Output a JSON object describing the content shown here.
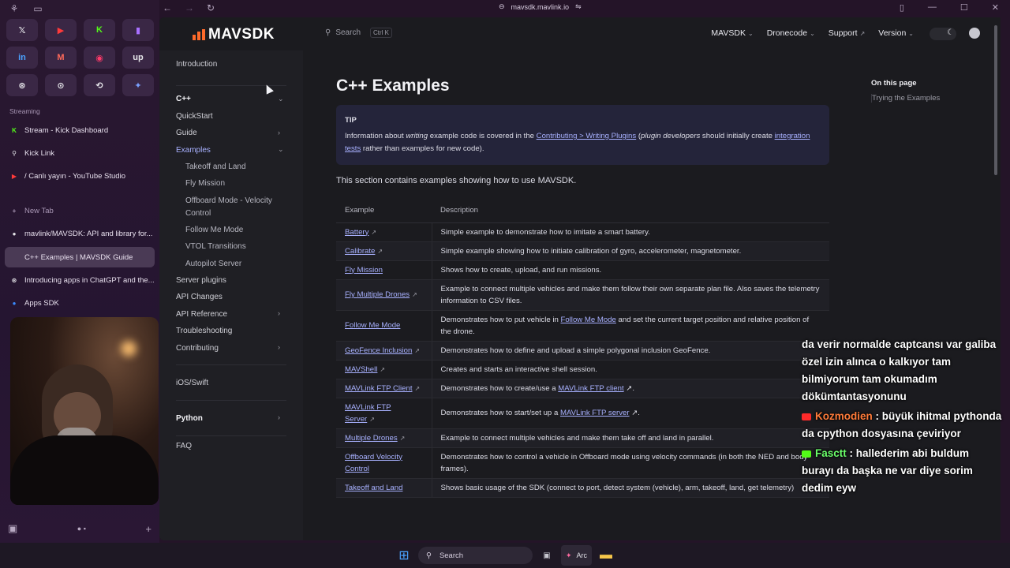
{
  "browser": {
    "url": "mavsdk.mavlink.io"
  },
  "arc": {
    "favorites": [
      {
        "icon": "x-icon",
        "glyph": "𝕏",
        "color": "#e6e6ea"
      },
      {
        "icon": "youtube-icon",
        "glyph": "▶",
        "color": "#ff3a3a"
      },
      {
        "icon": "kick-icon",
        "glyph": "K",
        "color": "#53fc18"
      },
      {
        "icon": "twitch-icon",
        "glyph": "▮",
        "color": "#a970ff"
      },
      {
        "icon": "linkedin-icon",
        "glyph": "in",
        "color": "#4aa3ff"
      },
      {
        "icon": "gmail-icon",
        "glyph": "M",
        "color": "#ff6a5a"
      },
      {
        "icon": "record-icon",
        "glyph": "◉",
        "color": "#ff3a6a"
      },
      {
        "icon": "upwork-icon",
        "glyph": "up",
        "color": "#e6e6ea"
      },
      {
        "icon": "chatgpt-icon",
        "glyph": "⊛",
        "color": "#e6e6ea"
      },
      {
        "icon": "target-icon",
        "glyph": "⊙",
        "color": "#e6e6ea"
      },
      {
        "icon": "sync-icon",
        "glyph": "⟲",
        "color": "#e6e6ea"
      },
      {
        "icon": "gemini-icon",
        "glyph": "✦",
        "color": "#7aa0ff"
      }
    ],
    "section_label": "Streaming",
    "tabs": [
      {
        "label": "Stream - Kick Dashboard",
        "glyph": "K",
        "color": "#53fc18"
      },
      {
        "label": "Kick Link",
        "glyph": "⚲",
        "color": "#e6e6ea"
      },
      {
        "label": "/ Canlı yayın - YouTube Studio",
        "glyph": "▶",
        "color": "#ff3a3a"
      }
    ],
    "new_tab": "New Tab",
    "open_tabs": [
      {
        "label": "mavlink/MAVSDK: API and library for...",
        "glyph": "●",
        "color": "#e6e6ea"
      },
      {
        "label": "C++ Examples | MAVSDK Guide",
        "glyph": "",
        "color": "#4a3a55"
      },
      {
        "label": "Introducing apps in ChatGPT and the...",
        "glyph": "⊛",
        "color": "#e6e6ea"
      },
      {
        "label": "Apps SDK",
        "glyph": "●",
        "color": "#3a8bff"
      }
    ]
  },
  "site": {
    "logo": "MAVSDK",
    "search_label": "Search",
    "search_shortcut": "Ctrl K",
    "nav": [
      {
        "label": "MAVSDK",
        "suffix": "⌄"
      },
      {
        "label": "Dronecode",
        "suffix": "⌄"
      },
      {
        "label": "Support",
        "suffix": "↗"
      },
      {
        "label": "Version",
        "suffix": "⌄"
      }
    ]
  },
  "docs_nav": {
    "introduction": "Introduction",
    "cpp": "C++",
    "quickstart": "QuickStart",
    "guide": "Guide",
    "examples": "Examples",
    "examples_children": [
      "Takeoff and Land",
      "Fly Mission",
      "Offboard Mode - Velocity",
      "Control",
      "Follow Me Mode",
      "VTOL Transitions",
      "Autopilot Server"
    ],
    "server_plugins": "Server plugins",
    "api_changes": "API Changes",
    "api_reference": "API Reference",
    "troubleshooting": "Troubleshooting",
    "contributing": "Contributing",
    "ios_swift": "iOS/Swift",
    "python": "Python",
    "faq": "FAQ"
  },
  "content": {
    "title": "C++ Examples",
    "tip_title": "TIP",
    "tip_parts": {
      "p1": "Information about ",
      "em1": "writing",
      "p2": " example code is covered in the ",
      "link1": "Contributing > Writing Plugins",
      "p3": " (",
      "em2": "plugin developers",
      "p4": " should initially create ",
      "link2": "integration tests",
      "p5": " rather than examples for new code)."
    },
    "intro": "This section contains examples showing how to use MAVSDK.",
    "table_headers": [
      "Example",
      "Description"
    ],
    "rows": [
      {
        "name": "Battery",
        "ext": true,
        "desc": "Simple example to demonstrate how to imitate a smart battery."
      },
      {
        "name": "Calibrate",
        "ext": true,
        "desc": "Simple example showing how to initiate calibration of gyro, accelerometer, magnetometer."
      },
      {
        "name": "Fly Mission",
        "ext": false,
        "desc": "Shows how to create, upload, and run missions."
      },
      {
        "name": "Fly Multiple Drones",
        "ext": true,
        "desc": "Example to connect multiple vehicles and make them follow their own separate plan file. Also saves the telemetry information to CSV files."
      },
      {
        "name": "Follow Me Mode",
        "ext": false,
        "desc_pre": "Demonstrates how to put vehicle in ",
        "desc_link": "Follow Me Mode",
        "desc_post": " and set the current target position and relative position of the drone."
      },
      {
        "name": "GeoFence Inclusion",
        "ext": true,
        "desc": "Demonstrates how to define and upload a simple polygonal inclusion GeoFence."
      },
      {
        "name": "MAVShell",
        "ext": true,
        "desc": "Creates and starts an interactive shell session."
      },
      {
        "name": "MAVLink FTP Client",
        "ext": true,
        "desc_pre": "Demonstrates how to create/use a ",
        "desc_link": "MAVLink FTP client",
        "desc_post": " ↗."
      },
      {
        "name": "MAVLink FTP Server",
        "ext": true,
        "desc_pre": "Demonstrates how to start/set up a ",
        "desc_link": "MAVLink FTP server",
        "desc_post": " ↗."
      },
      {
        "name": "Multiple Drones",
        "ext": true,
        "desc": "Example to connect multiple vehicles and make them take off and land in parallel."
      },
      {
        "name": "Offboard Velocity Control",
        "ext": false,
        "desc": "Demonstrates how to control a vehicle in Offboard mode using velocity commands (in both the NED and body frames)."
      },
      {
        "name": "Takeoff and Land",
        "ext": false,
        "desc": "Shows basic usage of the SDK (connect to port, detect system (vehicle), arm, takeoff, land, get telemetry)"
      }
    ]
  },
  "on_this_page": {
    "title": "On this page",
    "items": [
      "Trying the Examples"
    ]
  },
  "chat": {
    "lines": [
      "da verir normalde captcansı var galiba",
      "özel izin alınca o kalkıyor tam",
      "bilmiyorum tam okumadım",
      "dökümtantasyonunu"
    ],
    "messages": [
      {
        "user": "Kozmodien",
        "platform": "youtube",
        "text": " : büyük ihitmal pythonda",
        "cont": "da cpython dosyasına çeviriyor"
      },
      {
        "user": "Fasctt",
        "platform": "kick",
        "text": " : hallederim abi buldum",
        "cont": "burayı da başka ne var diye sorim",
        "cont2": "dedim eyw"
      }
    ]
  },
  "taskbar": {
    "search": "Search",
    "arc_label": "Arc"
  }
}
